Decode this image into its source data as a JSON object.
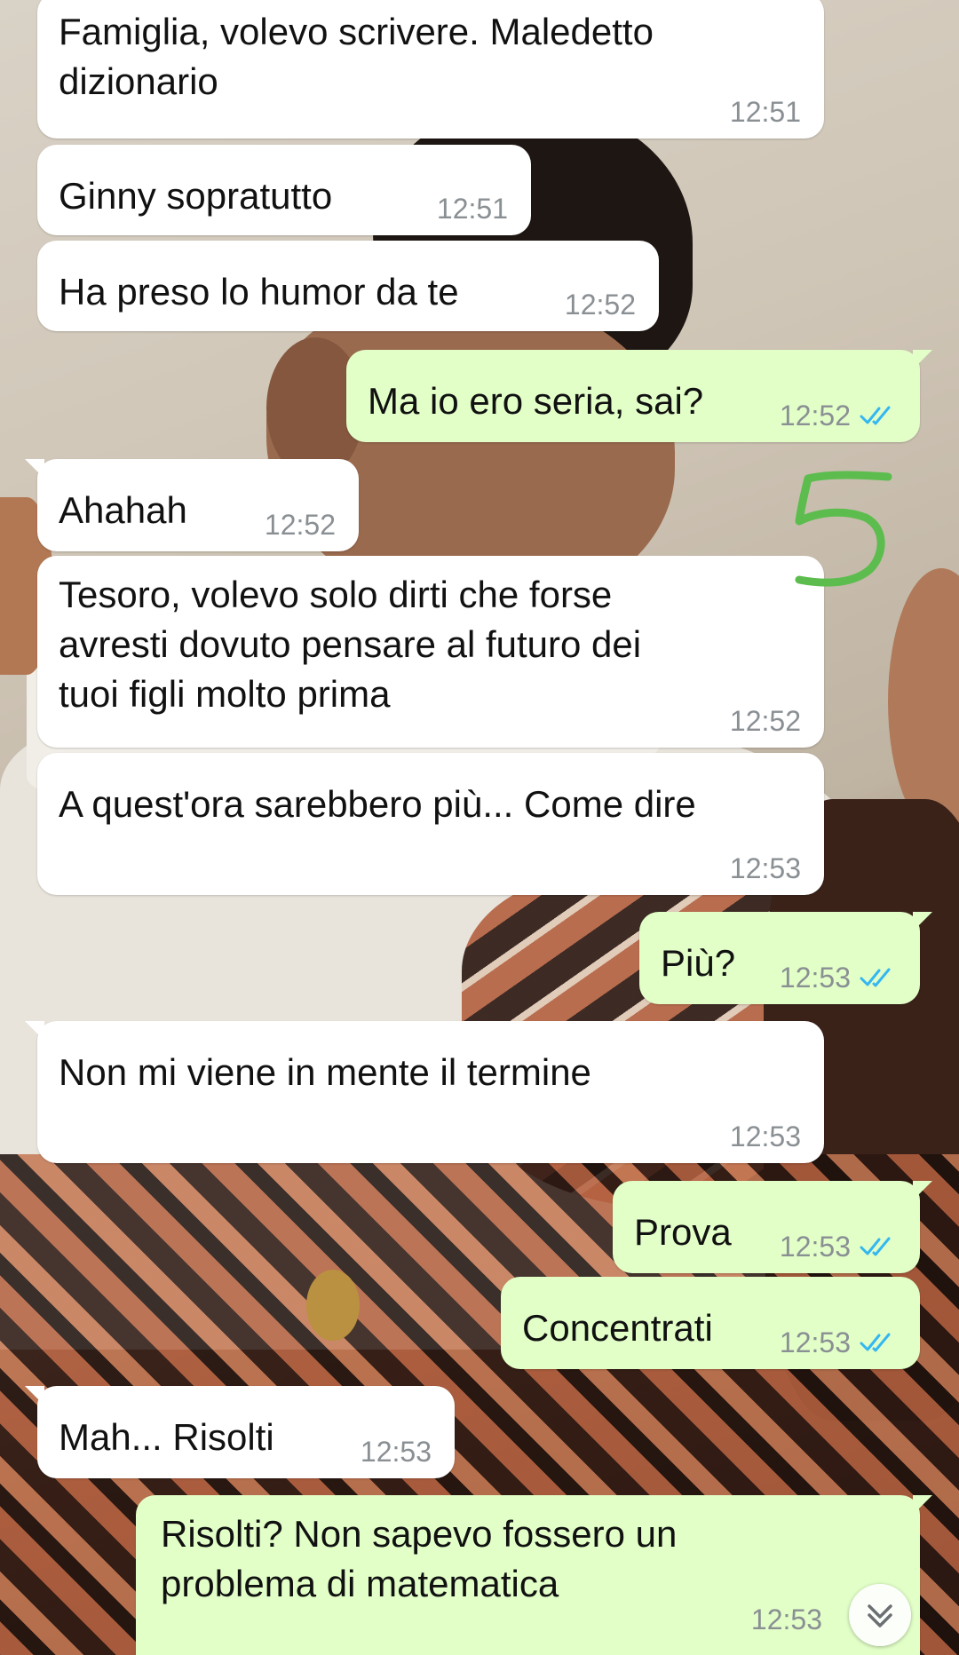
{
  "messages": [
    {
      "dir": "in",
      "text": "Famiglia, volevo scrivere. Maledetto\ndizionario",
      "time": "12:51"
    },
    {
      "dir": "in",
      "text": "Ginny sopratutto",
      "time": "12:51"
    },
    {
      "dir": "in",
      "text": "Ha preso lo humor da te",
      "time": "12:52"
    },
    {
      "dir": "out",
      "text": "Ma io ero seria, sai?",
      "time": "12:52"
    },
    {
      "dir": "in",
      "text": "Ahahah",
      "time": "12:52"
    },
    {
      "dir": "in",
      "text": "Tesoro, volevo solo dirti che forse\navresti dovuto pensare al futuro dei\ntuoi figli molto prima",
      "time": "12:52"
    },
    {
      "dir": "in",
      "text": "A quest'ora sarebbero più... Come dire",
      "time": "12:53"
    },
    {
      "dir": "out",
      "text": "Più?",
      "time": "12:53"
    },
    {
      "dir": "in",
      "text": "Non mi viene in mente il termine",
      "time": "12:53"
    },
    {
      "dir": "out",
      "text": "Prova",
      "time": "12:53"
    },
    {
      "dir": "out",
      "text": "Concentrati",
      "time": "12:53"
    },
    {
      "dir": "in",
      "text": "Mah... Risolti",
      "time": "12:53"
    },
    {
      "dir": "out",
      "text": "Risolti? Non sapevo fossero un\nproblema di matematica",
      "time": "12:53"
    }
  ],
  "annotation": {
    "label": "5",
    "color": "#5cbd4e"
  },
  "colors": {
    "incoming": "#ffffff",
    "outgoing": "#e2ffc8",
    "read_ticks": "#34b7f1",
    "timestamp": "#8a8f93"
  },
  "icons": {
    "read_receipt": "double-check-icon",
    "scroll_down": "double-chevron-down-icon"
  }
}
